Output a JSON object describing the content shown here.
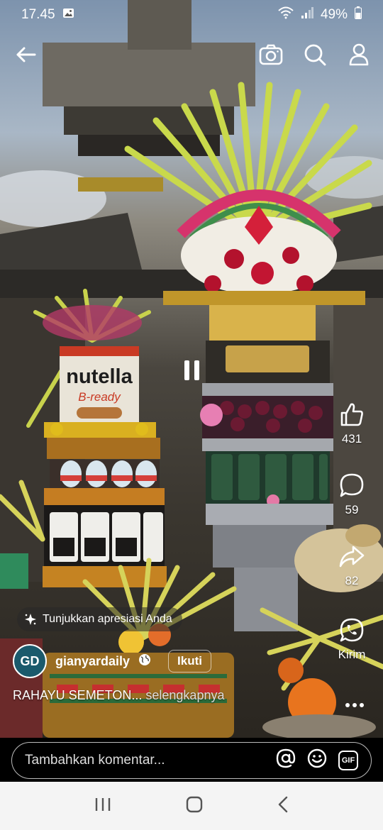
{
  "status_bar": {
    "time": "17.45",
    "battery": "49%"
  },
  "top_bar": {
    "back_icon": "arrow-left-icon",
    "camera_icon": "camera-icon",
    "search_icon": "search-icon",
    "profile_icon": "person-icon"
  },
  "video": {
    "product_brand": "nutella",
    "product_subtitle": "B-ready"
  },
  "rail": {
    "likes": "431",
    "comments": "59",
    "shares": "82",
    "whatsapp_label": "Kirim"
  },
  "appreciation": {
    "text": "Tunjukkan apresiasi Anda"
  },
  "author": {
    "avatar_text": "GD",
    "username": "gianyardaily",
    "follow_label": "Ikuti"
  },
  "caption": {
    "text": "RAHAYU SEMETON...",
    "more": "selengkapnya"
  },
  "comment": {
    "placeholder": "Tambahkan komentar...",
    "gif_label": "GIF"
  },
  "colors": {
    "accent": "#ffffff",
    "nav_bg": "#f4f4f4"
  }
}
